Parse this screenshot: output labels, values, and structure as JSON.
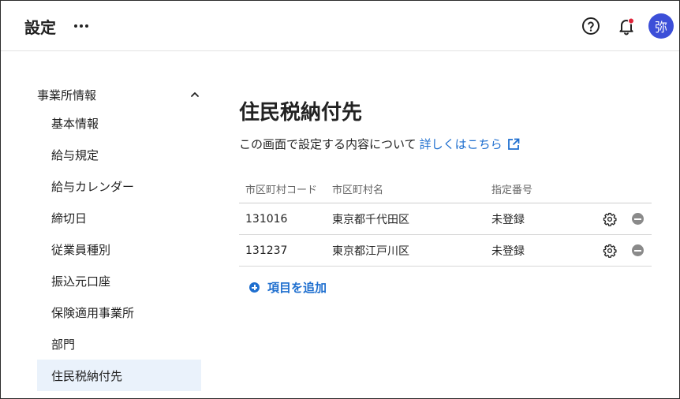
{
  "header": {
    "title": "設定",
    "more_icon": "more-horizontal-icon",
    "help_icon": "help-circle-icon",
    "notification_icon": "bell-icon",
    "avatar_initial": "弥",
    "avatar_color": "#3c4fd8",
    "notification_dot_color": "#e0243a"
  },
  "sidebar": {
    "section_title": "事業所情報",
    "section_icon": "chevron-up-icon",
    "items": [
      {
        "label": "基本情報"
      },
      {
        "label": "給与規定"
      },
      {
        "label": "給与カレンダー"
      },
      {
        "label": "締切日"
      },
      {
        "label": "従業員種別"
      },
      {
        "label": "振込元口座"
      },
      {
        "label": "保険適用事業所"
      },
      {
        "label": "部門"
      },
      {
        "label": "住民税納付先",
        "active": true
      }
    ]
  },
  "main": {
    "title": "住民税納付先",
    "description": "この画面で設定する内容について",
    "link_label": "詳しくはこちら",
    "link_icon": "external-link-icon",
    "accent_color": "#1f6fcf",
    "table": {
      "columns": [
        "市区町村コード",
        "市区町村名",
        "指定番号"
      ],
      "rows": [
        {
          "code": "131016",
          "name": "東京都千代田区",
          "number": "未登録"
        },
        {
          "code": "131237",
          "name": "東京都江戸川区",
          "number": "未登録"
        }
      ],
      "row_icons": [
        "gear-icon",
        "remove-circle-icon"
      ]
    },
    "add_button_label": "項目を追加",
    "add_icon": "plus-circle-icon"
  }
}
